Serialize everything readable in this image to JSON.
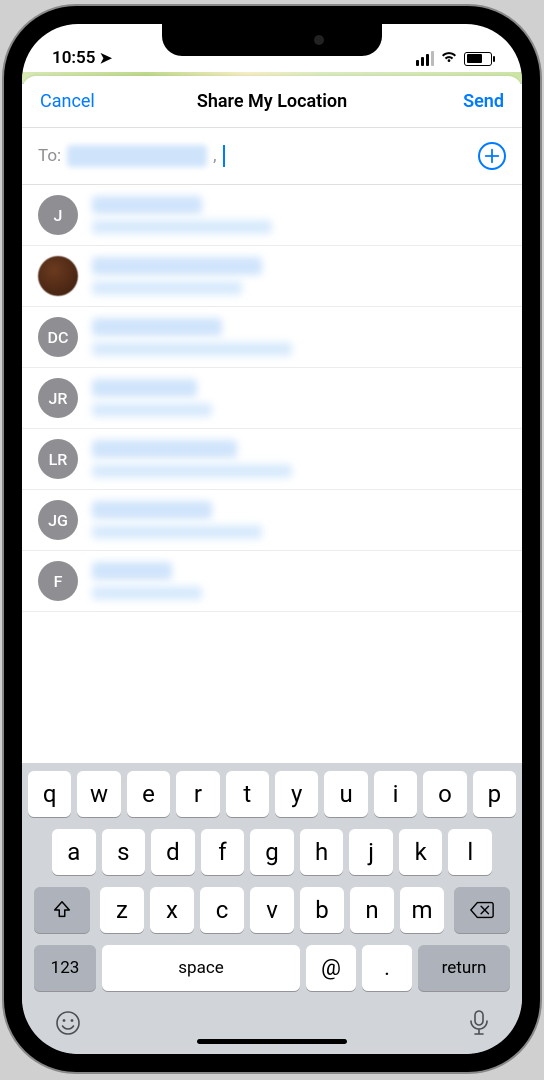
{
  "status": {
    "time": "10:55"
  },
  "nav": {
    "cancel": "Cancel",
    "title": "Share My Location",
    "send": "Send"
  },
  "to_field": {
    "label": "To:"
  },
  "contacts": [
    {
      "initials": "J",
      "photo": false,
      "name_w": 110,
      "sub_w": 180
    },
    {
      "initials": "",
      "photo": true,
      "name_w": 170,
      "sub_w": 150
    },
    {
      "initials": "DC",
      "photo": false,
      "name_w": 130,
      "sub_w": 200
    },
    {
      "initials": "JR",
      "photo": false,
      "name_w": 105,
      "sub_w": 120
    },
    {
      "initials": "LR",
      "photo": false,
      "name_w": 145,
      "sub_w": 200
    },
    {
      "initials": "JG",
      "photo": false,
      "name_w": 120,
      "sub_w": 170
    },
    {
      "initials": "F",
      "photo": false,
      "name_w": 80,
      "sub_w": 110
    }
  ],
  "keyboard": {
    "row1": [
      "q",
      "w",
      "e",
      "r",
      "t",
      "y",
      "u",
      "i",
      "o",
      "p"
    ],
    "row2": [
      "a",
      "s",
      "d",
      "f",
      "g",
      "h",
      "j",
      "k",
      "l"
    ],
    "row3": [
      "z",
      "x",
      "c",
      "v",
      "b",
      "n",
      "m"
    ],
    "numkey": "123",
    "space": "space",
    "at": "@",
    "dot": ".",
    "return": "return"
  }
}
